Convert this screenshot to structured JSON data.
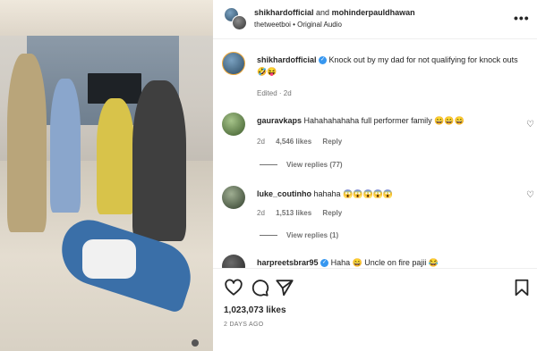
{
  "post": {
    "author": "shikhardofficial",
    "collaborator_joiner": "and",
    "collaborator": "mohinderpaul​dhawan",
    "audio_line": "thetweetboi • Original Audio",
    "caption_user": "shikhardofficial",
    "caption_text": "Knock out by my dad for not qualifying for knock outs 🤣😝",
    "caption_meta": "Edited · 2d"
  },
  "comments": [
    {
      "user": "gauravkaps",
      "text": "Hahahahahaha full performer family 😄😄😄",
      "age": "2d",
      "likes": "4,546 likes",
      "reply": "Reply",
      "view_replies": "View replies (77)"
    },
    {
      "user": "luke_coutinho",
      "text": "hahaha 😱😱😱😱😱",
      "age": "2d",
      "likes": "1,513 likes",
      "reply": "Reply",
      "view_replies": "View replies (1)"
    },
    {
      "user": "harpreetsbrar95",
      "text": "Haha 😄 Uncle on fire pajii 😂"
    }
  ],
  "footer": {
    "likes": "1,023,073 likes",
    "date": "2 DAYS AGO"
  },
  "icons": {
    "more": "more-options-icon",
    "like": "heart-icon",
    "comment": "comment-icon",
    "share": "share-icon",
    "save": "bookmark-icon"
  },
  "colors": {
    "verified": "#3797f0",
    "text": "#262626",
    "muted": "#737373"
  }
}
